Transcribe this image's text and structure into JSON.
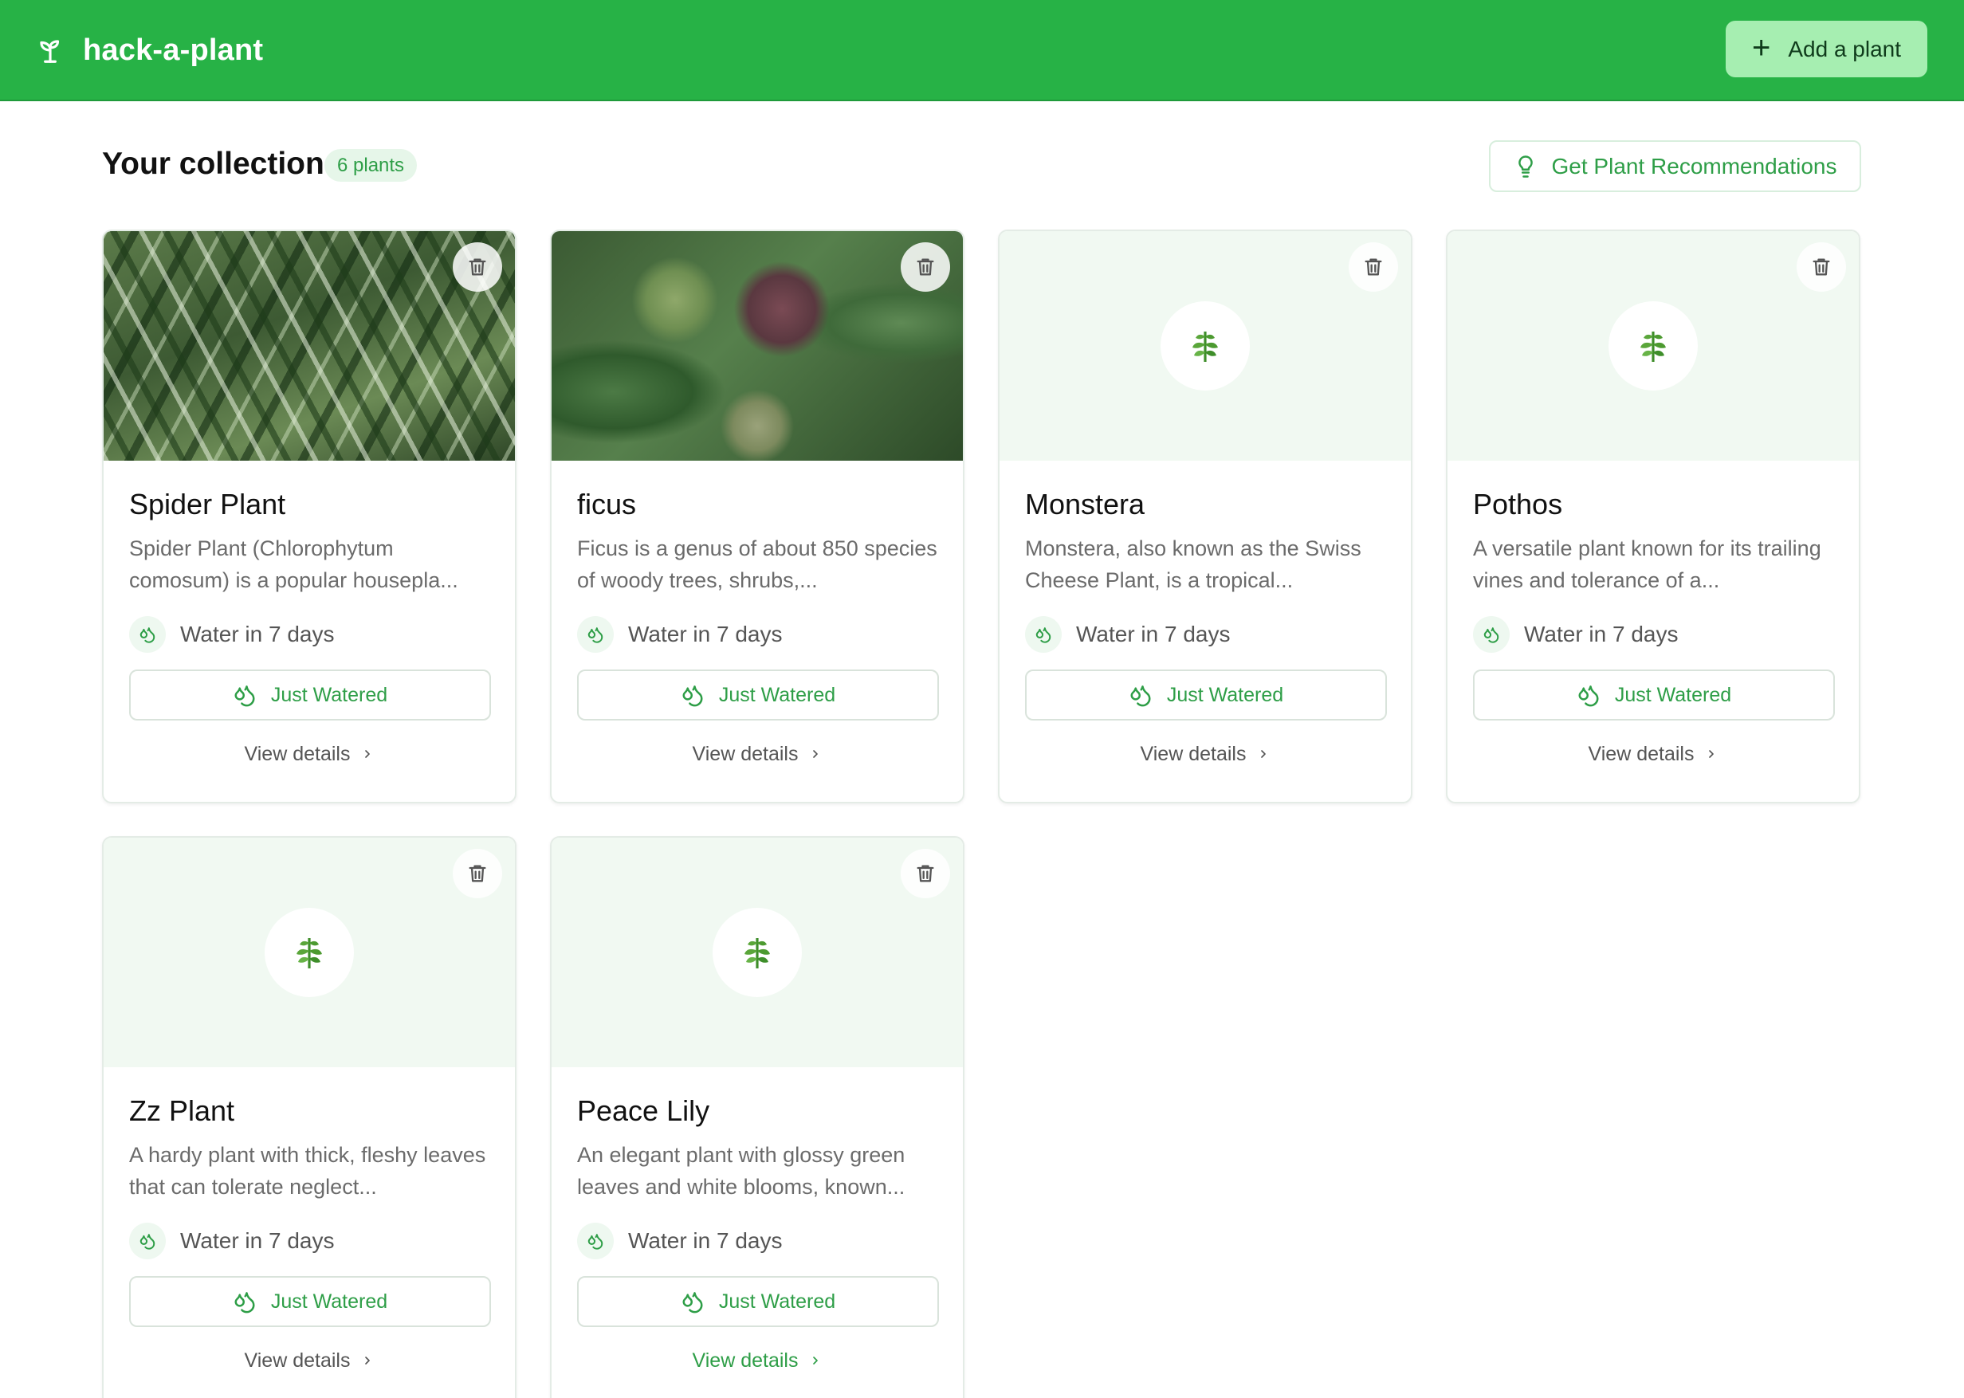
{
  "app": {
    "name": "hack-a-plant"
  },
  "header": {
    "add_button_label": "Add a plant",
    "add_button_icon": "+"
  },
  "collection": {
    "title": "Your collection",
    "count_label": "6 plants",
    "recommend_button_label": "Get Plant Recommendations"
  },
  "colors": {
    "brand": "#27b246",
    "accent_text": "#2e9e47",
    "add_button_bg": "#a6eeb1",
    "placeholder_bg": "#f1f9f2"
  },
  "plants": [
    {
      "name": "Spider Plant",
      "description": "Spider Plant (Chlorophytum comosum) is a popular housepla...",
      "water_status": "Water in 7 days",
      "action_label": "Just Watered",
      "details_label": "View details",
      "image": "photo-spider-plant"
    },
    {
      "name": "ficus",
      "description": "Ficus is a genus of about 850 species of woody trees, shrubs,...",
      "water_status": "Water in 7 days",
      "action_label": "Just Watered",
      "details_label": "View details",
      "image": "photo-ficus"
    },
    {
      "name": "Monstera",
      "description": "Monstera, also known as the Swiss Cheese Plant, is a tropical...",
      "water_status": "Water in 7 days",
      "action_label": "Just Watered",
      "details_label": "View details",
      "image": "leaf-placeholder-icon"
    },
    {
      "name": "Pothos",
      "description": "A versatile plant known for its trailing vines and tolerance of a...",
      "water_status": "Water in 7 days",
      "action_label": "Just Watered",
      "details_label": "View details",
      "image": "leaf-placeholder-icon"
    },
    {
      "name": "Zz Plant",
      "description": "A hardy plant with thick, fleshy leaves that can tolerate neglect...",
      "water_status": "Water in 7 days",
      "action_label": "Just Watered",
      "details_label": "View details",
      "image": "leaf-placeholder-icon"
    },
    {
      "name": "Peace Lily",
      "description": "An elegant plant with glossy green leaves and white blooms, known...",
      "water_status": "Water in 7 days",
      "action_label": "Just Watered",
      "details_label": "View details",
      "image": "leaf-placeholder-icon"
    }
  ]
}
